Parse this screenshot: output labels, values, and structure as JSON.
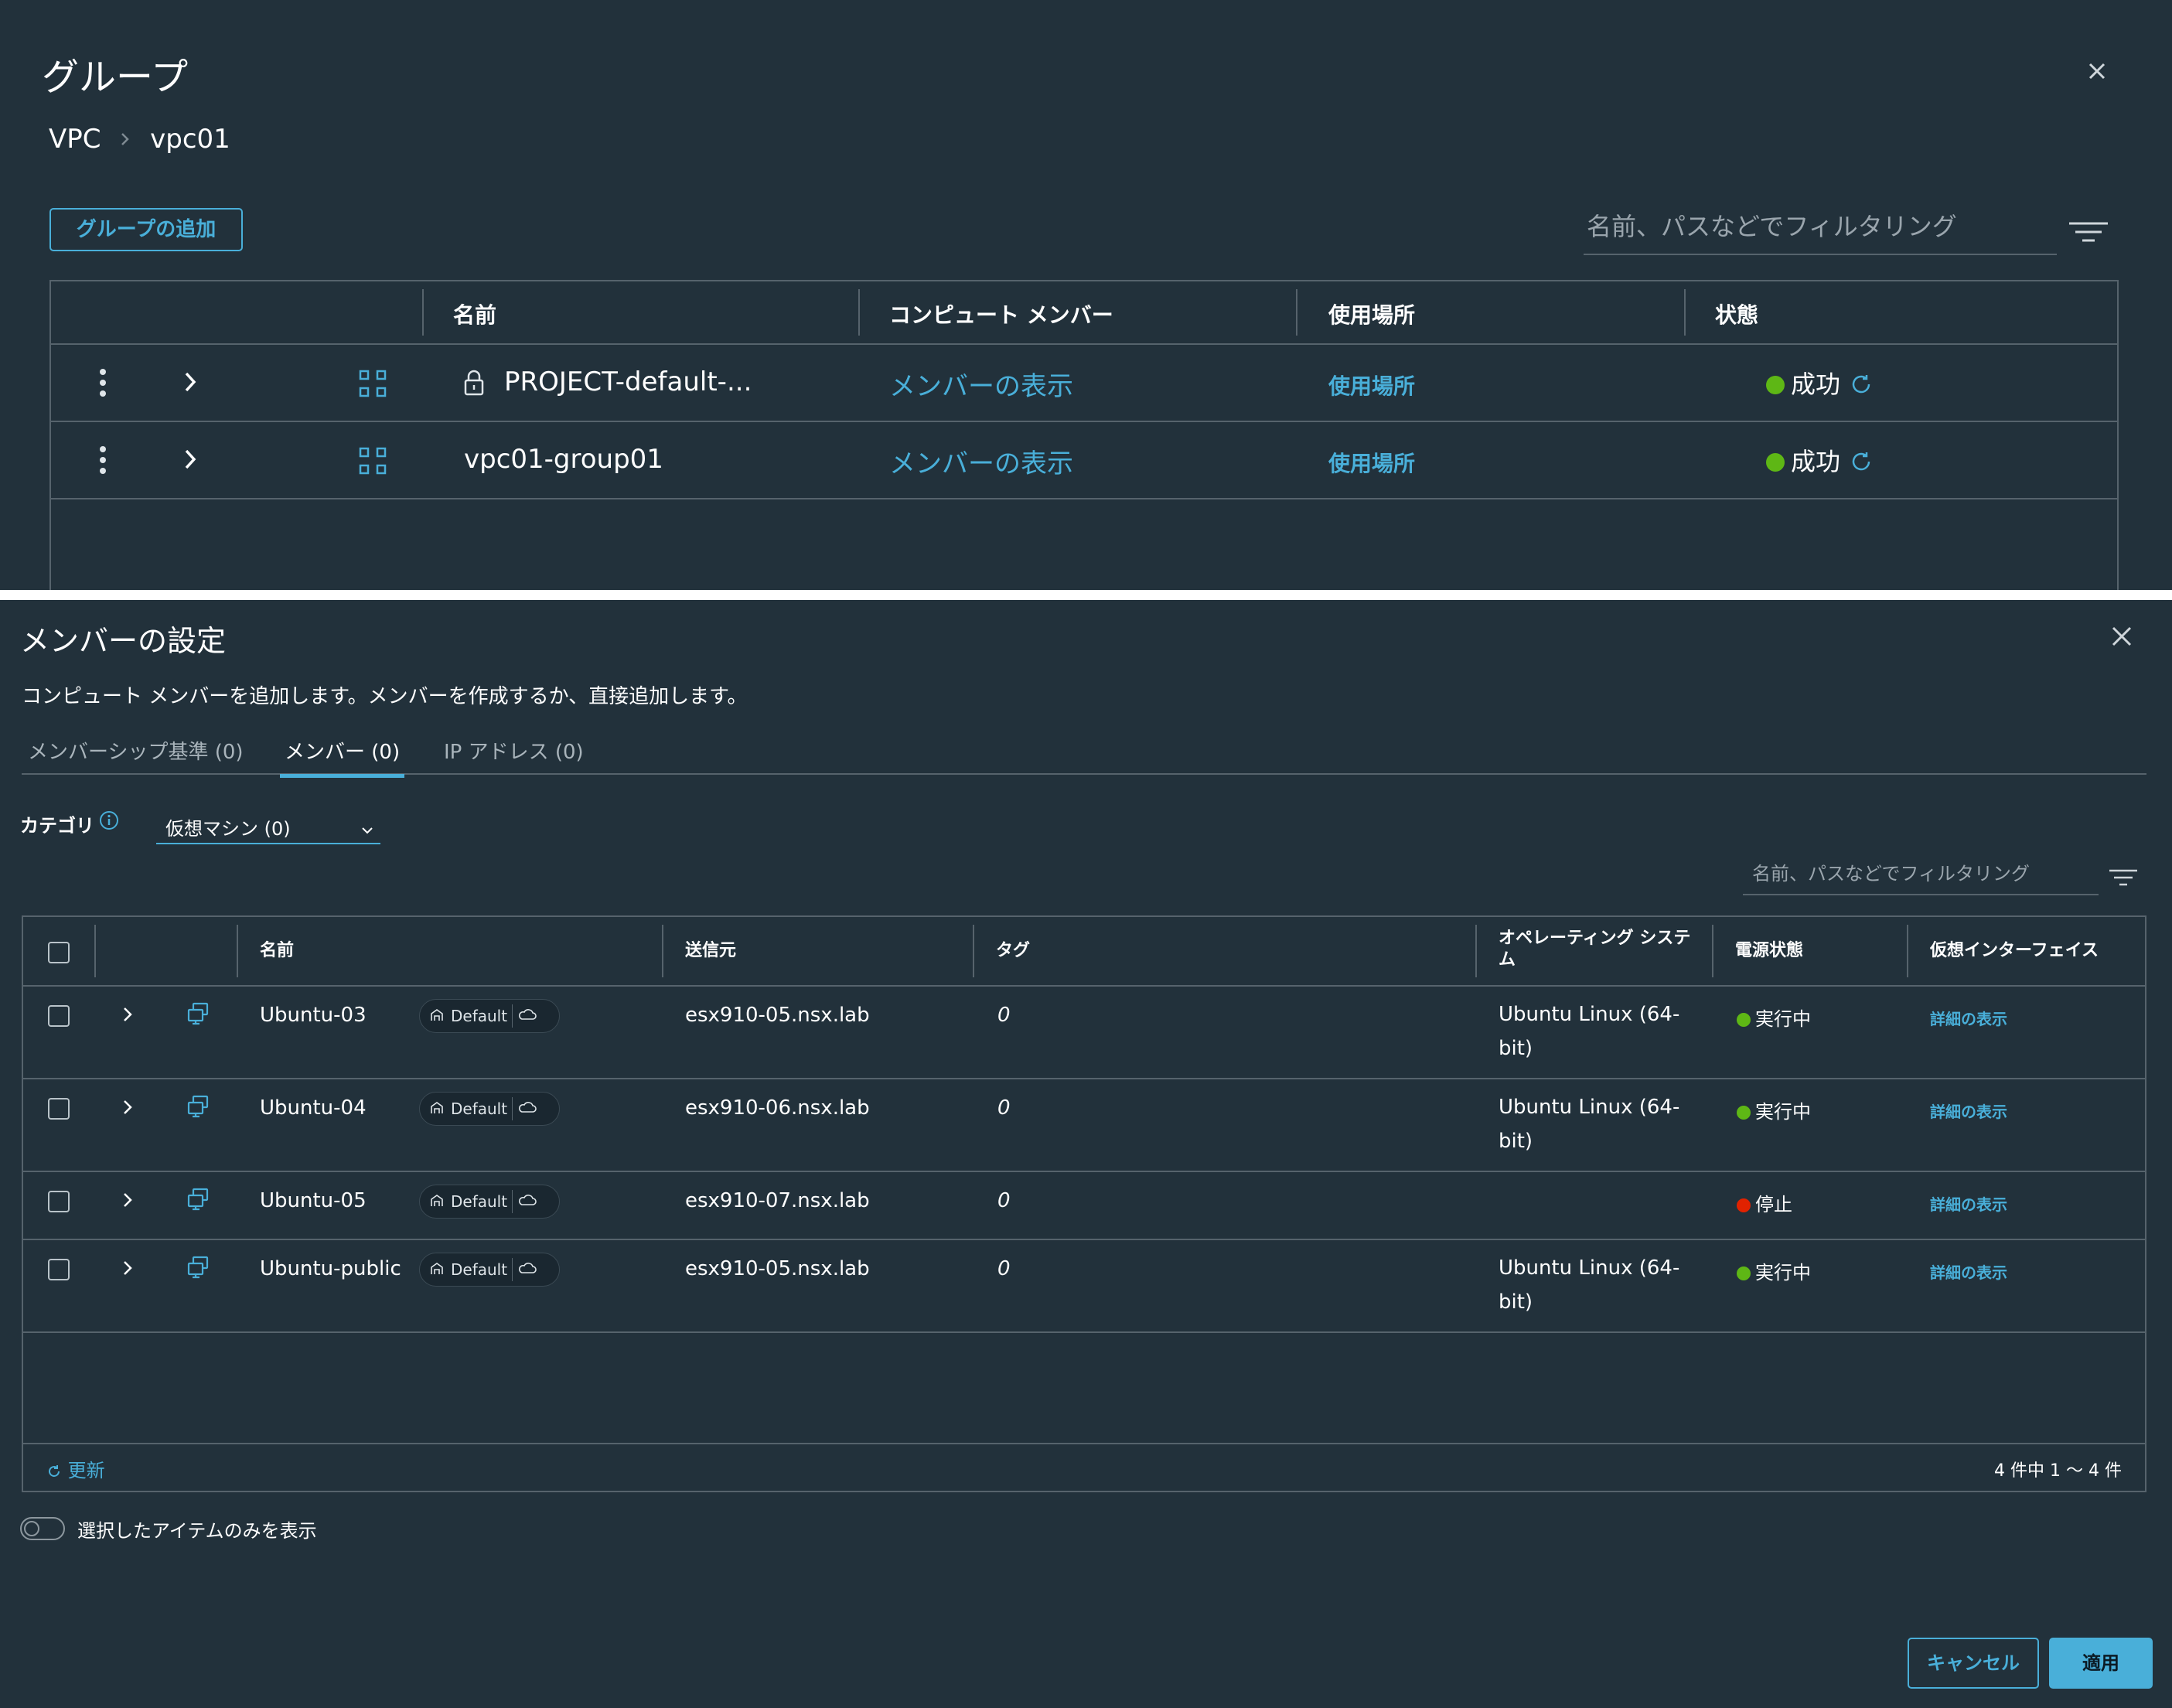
{
  "group_panel": {
    "title": "グループ",
    "breadcrumb": [
      "VPC",
      "vpc01"
    ],
    "add_button": "グループの追加",
    "search_placeholder": "名前、パスなどでフィルタリング",
    "columns": [
      "名前",
      "コンピュート メンバー",
      "使用場所",
      "状態"
    ],
    "rows": [
      {
        "name": "PROJECT-default-...",
        "locked": true,
        "members_link": "メンバーの表示",
        "used_link": "使用場所",
        "status": "成功"
      },
      {
        "name": "vpc01-group01",
        "locked": false,
        "members_link": "メンバーの表示",
        "used_link": "使用場所",
        "status": "成功"
      }
    ]
  },
  "member_dialog": {
    "title": "メンバーの設定",
    "subtitle": "コンピュート メンバーを追加します。メンバーを作成するか、直接追加します。",
    "tabs": [
      "メンバーシップ基準 (0)",
      "メンバー (0)",
      "IP アドレス (0)"
    ],
    "active_tab": 1,
    "category_label": "カテゴリ",
    "category_value": "仮想マシン (0)",
    "search_placeholder": "名前、パスなどでフィルタリング",
    "columns": [
      "名前",
      "送信元",
      "タグ",
      "オペレーティング システム",
      "電源状態",
      "仮想インターフェイス"
    ],
    "rows": [
      {
        "name": "Ubuntu-03",
        "pill": "Default",
        "source": "esx910-05.nsx.lab",
        "tags": "0",
        "os": "Ubuntu Linux (64-bit)",
        "power": "実行中",
        "power_color": "#5eb715",
        "vif": "詳細の表示"
      },
      {
        "name": "Ubuntu-04",
        "pill": "Default",
        "source": "esx910-06.nsx.lab",
        "tags": "0",
        "os": "Ubuntu Linux (64-bit)",
        "power": "実行中",
        "power_color": "#5eb715",
        "vif": "詳細の表示"
      },
      {
        "name": "Ubuntu-05",
        "pill": "Default",
        "source": "esx910-07.nsx.lab",
        "tags": "0",
        "os": "",
        "power": "停止",
        "power_color": "#e12200",
        "vif": "詳細の表示"
      },
      {
        "name": "Ubuntu-public",
        "pill": "Default",
        "source": "esx910-05.nsx.lab",
        "tags": "0",
        "os": "Ubuntu Linux (64-bit)",
        "power": "実行中",
        "power_color": "#5eb715",
        "vif": "詳細の表示"
      }
    ],
    "refresh_label": "更新",
    "count_label": "4 件中 1 ～ 4 件",
    "toggle_label": "選択したアイテムのみを表示",
    "cancel_button": "キャンセル",
    "apply_button": "適用"
  },
  "colors": {
    "accent": "#49afd9",
    "background": "#22313b",
    "success": "#5eb715",
    "stopped": "#e12200"
  }
}
